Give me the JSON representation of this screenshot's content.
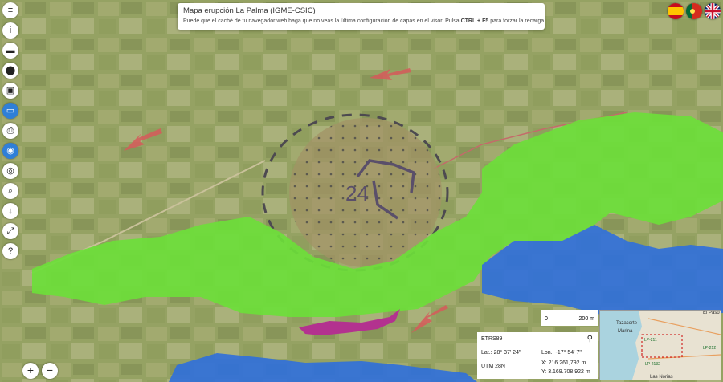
{
  "title": "Mapa erupción La Palma (IGME-CSIC)",
  "notice_prefix": "Puede que el caché de tu navegador web haga que no veas la última configuración de capas en el visor. Pulsa ",
  "notice_keys": "CTRL + F5",
  "notice_suffix": " para forzar la recarga",
  "marker_label": "24",
  "toolbar": [
    {
      "icon": "layers-icon",
      "glyph": "≡"
    },
    {
      "icon": "info-icon",
      "glyph": "i"
    },
    {
      "icon": "ruler-icon",
      "glyph": "▬"
    },
    {
      "icon": "location-pin-icon",
      "glyph": "⬤"
    },
    {
      "icon": "add-layer-icon",
      "glyph": "▣"
    },
    {
      "icon": "minimap-icon",
      "glyph": "▭",
      "active": true
    },
    {
      "icon": "print-icon",
      "glyph": "⎙"
    },
    {
      "icon": "mouse-icon",
      "glyph": "◉",
      "active": true
    },
    {
      "icon": "target-icon",
      "glyph": "◎"
    },
    {
      "icon": "zoom-box-icon",
      "glyph": "⌕"
    },
    {
      "icon": "download-icon",
      "glyph": "↓"
    },
    {
      "icon": "fullscreen-icon",
      "glyph": "⤢"
    },
    {
      "icon": "help-icon",
      "glyph": "?"
    }
  ],
  "languages": [
    "es",
    "pt",
    "en"
  ],
  "scale": {
    "start": "0",
    "end": "200 m"
  },
  "coords": {
    "datum": "ETRS89",
    "lat_label": "Lat.:",
    "lat": "28° 37' 24\"",
    "lon_label": "Lon.:",
    "lon": "-17° 54' 7\"",
    "utm": "UTM 28N",
    "x_label": "X:",
    "x": "216.261,792 m",
    "y_label": "Y:",
    "y": "3.169.708,922 m"
  },
  "overview": {
    "labels": [
      "Tazacorte",
      "Marina",
      "El Paso",
      "Las Norias",
      "LP-212",
      "LP-211",
      "LP-2132"
    ]
  },
  "zoom": {
    "in": "+",
    "out": "−"
  },
  "colors": {
    "lava_green": "#6dde3a",
    "ocean_blue": "#2f6fdc",
    "magenta": "#b3328f",
    "accent": "#2f7fd8"
  }
}
